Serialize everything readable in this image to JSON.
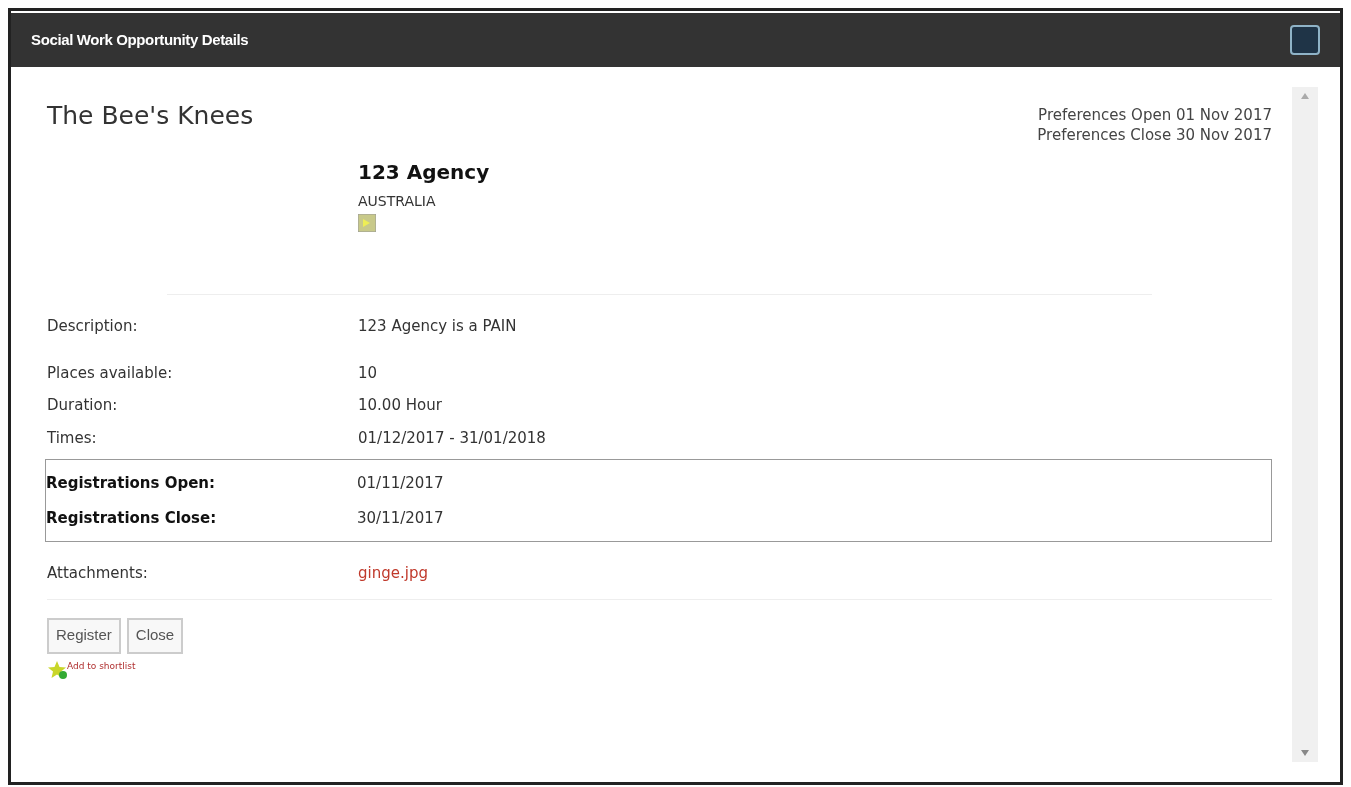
{
  "window": {
    "title": "Social Work Opportunity Details"
  },
  "heading": "The Bee's Knees",
  "preferences": [
    "Preferences Open 01 Nov 2017",
    "Preferences Close 30 Nov 2017"
  ],
  "agency": {
    "name": "123 Agency",
    "country": "AUSTRALIA"
  },
  "details": [
    {
      "label": "Description:",
      "value": "123 Agency is a PAIN"
    },
    {
      "label": "Places available:",
      "value": "10"
    },
    {
      "label": "Duration:",
      "value": "10.00 Hour"
    },
    {
      "label": "Times:",
      "value": "01/12/2017 - 31/01/2018"
    }
  ],
  "registrations": [
    {
      "label": "Registrations Open:",
      "value": "01/11/2017"
    },
    {
      "label": "Registrations Close:",
      "value": "30/11/2017"
    }
  ],
  "attachments": {
    "label": "Attachments:",
    "files": [
      "ginge.jpg"
    ]
  },
  "buttons": [
    "Register",
    "Close"
  ],
  "shortlist_link": "Add to shortlist"
}
